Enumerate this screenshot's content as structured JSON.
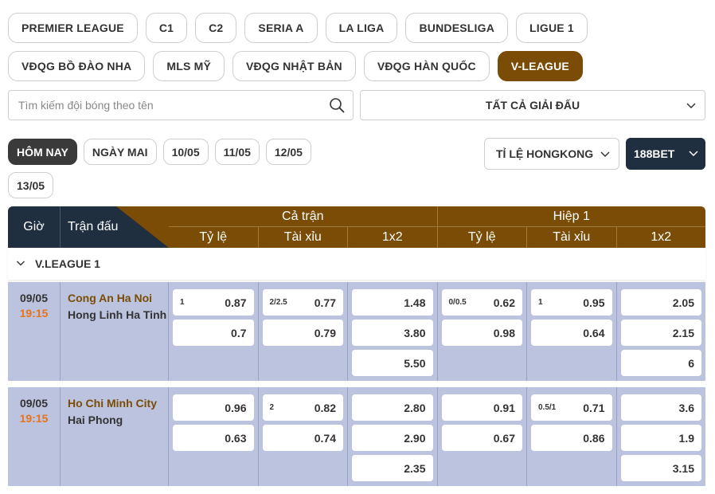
{
  "leagues": [
    "PREMIER LEAGUE",
    "C1",
    "C2",
    "SERIA A",
    "LA LIGA",
    "BUNDESLIGA",
    "LIGUE 1",
    "VĐQG BỒ ĐÀO NHA",
    "MLS MỸ",
    "VĐQG NHẬT BẢN",
    "VĐQG HÀN QUỐC",
    "V-LEAGUE"
  ],
  "active_league": "V-LEAGUE",
  "search": {
    "placeholder": "Tìm kiếm đội bóng theo tên"
  },
  "league_filter": {
    "selected": "TẤT CẢ GIẢI ĐẤU"
  },
  "dates": [
    "HÔM NAY",
    "NGÀY MAI",
    "10/05",
    "11/05",
    "12/05",
    "13/05"
  ],
  "active_date": "HÔM NAY",
  "odds_type": {
    "selected": "TỈ LỆ HONGKONG"
  },
  "bookmaker": {
    "selected": "188BET"
  },
  "table": {
    "col_time": "Giờ",
    "col_match": "Trận đấu",
    "group_full": "Cả trận",
    "group_half": "Hiệp 1",
    "sub_cols": [
      "Tỷ lệ",
      "Tài xỉu",
      "1x2",
      "Tỷ lệ",
      "Tài xỉu",
      "1x2"
    ]
  },
  "league_section": "V.LEAGUE 1",
  "matches": [
    {
      "date": "09/05",
      "time": "19:15",
      "home": "Cong An Ha Noi",
      "away": "Hong Linh Ha Tinh",
      "odds": [
        [
          {
            "l": "1",
            "v": "0.87"
          },
          {
            "l": "",
            "v": "0.7"
          }
        ],
        [
          {
            "l": "2/2.5",
            "v": "0.77"
          },
          {
            "l": "",
            "v": "0.79"
          }
        ],
        [
          {
            "l": "",
            "v": "1.48"
          },
          {
            "l": "",
            "v": "3.80"
          },
          {
            "l": "",
            "v": "5.50"
          }
        ],
        [
          {
            "l": "0/0.5",
            "v": "0.62"
          },
          {
            "l": "",
            "v": "0.98"
          }
        ],
        [
          {
            "l": "1",
            "v": "0.95"
          },
          {
            "l": "",
            "v": "0.64"
          }
        ],
        [
          {
            "l": "",
            "v": "2.05"
          },
          {
            "l": "",
            "v": "2.15"
          },
          {
            "l": "",
            "v": "6"
          }
        ]
      ]
    },
    {
      "date": "09/05",
      "time": "19:15",
      "home": "Ho Chi Minh City",
      "away": "Hai Phong",
      "odds": [
        [
          {
            "l": "",
            "v": "0.96"
          },
          {
            "l": "",
            "v": "0.63"
          }
        ],
        [
          {
            "l": "2",
            "v": "0.82"
          },
          {
            "l": "",
            "v": "0.74"
          }
        ],
        [
          {
            "l": "",
            "v": "2.80"
          },
          {
            "l": "",
            "v": "2.90"
          },
          {
            "l": "",
            "v": "2.35"
          }
        ],
        [
          {
            "l": "",
            "v": "0.91"
          },
          {
            "l": "",
            "v": "0.67"
          }
        ],
        [
          {
            "l": "0.5/1",
            "v": "0.71"
          },
          {
            "l": "",
            "v": "0.86"
          }
        ],
        [
          {
            "l": "",
            "v": "3.6"
          },
          {
            "l": "",
            "v": "1.9"
          },
          {
            "l": "",
            "v": "3.15"
          }
        ]
      ]
    }
  ],
  "colors": {
    "accent": "#7a4c05",
    "dark": "#1f2f3f",
    "time": "#e8731a",
    "row_bg": "#bcc3de"
  }
}
